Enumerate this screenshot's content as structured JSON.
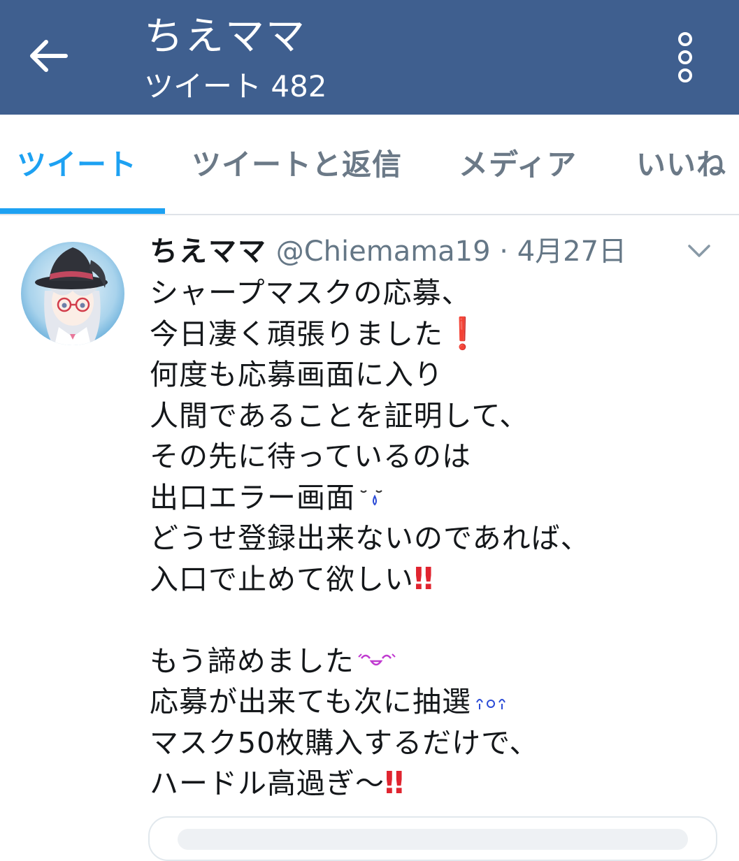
{
  "header": {
    "title": "ちえママ",
    "subtitle": "ツイート 482",
    "back_icon": "arrow-left-icon",
    "more_icon": "more-vertical-icon",
    "background": "#3f5f8f"
  },
  "tabs": [
    {
      "label": "ツイート",
      "active": true
    },
    {
      "label": "ツイートと返信",
      "active": false
    },
    {
      "label": "メディア",
      "active": false
    },
    {
      "label": "いいね",
      "active": false
    }
  ],
  "accent_color": "#1da1f2",
  "tweet": {
    "name": "ちえママ",
    "handle": "@Chiemama19",
    "separator": "·",
    "date": "4月27日",
    "lines": [
      "シャープマスクの応募、",
      "今日凄く頑張りました",
      "何度も応募画面に入り",
      "人間であることを証明して、",
      "その先に待っているのは",
      "出口エラー画面",
      "どうせ登録出来ないのであれば、",
      "入口で止めて欲しい",
      "",
      "もう諦めました",
      "応募が出来ても次に抽選",
      "マスク50枚購入するだけで、",
      "ハードル高過ぎ〜"
    ],
    "emojis": {
      "exclamation": "❗",
      "double_exclamation": "‼",
      "sweat": "sweat-kaomoji-icon",
      "laugh": "laughing-kaomoji-icon",
      "cry": "crying-kaomoji-icon"
    }
  }
}
